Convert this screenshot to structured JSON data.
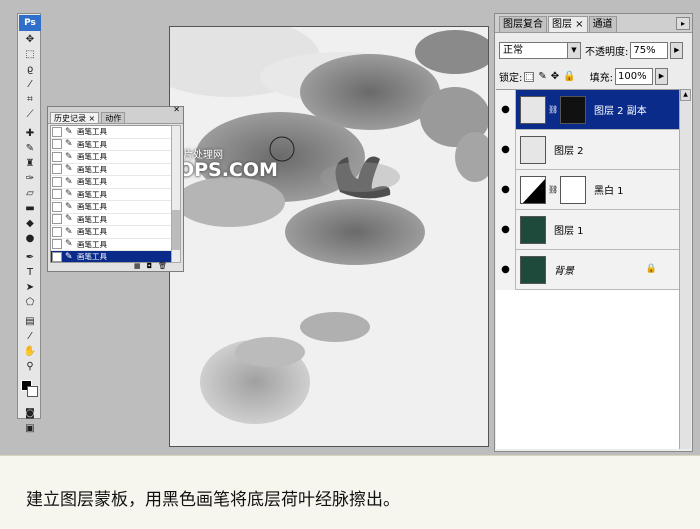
{
  "toolbox": {
    "logo": "Ps",
    "tools": [
      "move-icon",
      "marquee-icon",
      "lasso-icon",
      "magic-wand-icon",
      "crop-icon",
      "slice-icon",
      "healing-icon",
      "brush-icon",
      "stamp-icon",
      "history-brush-icon",
      "eraser-icon",
      "gradient-icon",
      "blur-icon",
      "dodge-icon",
      "pen-icon",
      "type-icon",
      "path-select-icon",
      "shape-icon",
      "notes-icon",
      "eyedropper-icon",
      "hand-icon",
      "zoom-icon"
    ],
    "foreground_color": "#000000",
    "background_color": "#ffffff"
  },
  "watermark": {
    "chinese": "照片处理网",
    "english": "PHOTOPS.COM"
  },
  "history": {
    "tabs": [
      {
        "label": "历史记录 ×"
      },
      {
        "label": "动作"
      }
    ],
    "items": [
      {
        "label": "画笔工具"
      },
      {
        "label": "画笔工具"
      },
      {
        "label": "画笔工具"
      },
      {
        "label": "画笔工具"
      },
      {
        "label": "画笔工具"
      },
      {
        "label": "画笔工具"
      },
      {
        "label": "画笔工具"
      },
      {
        "label": "画笔工具"
      },
      {
        "label": "画笔工具"
      },
      {
        "label": "画笔工具"
      },
      {
        "label": "画笔工具"
      }
    ],
    "selected_index": 10
  },
  "layers_panel": {
    "tabs": [
      {
        "label": "图层复合"
      },
      {
        "label": "图层 ×"
      },
      {
        "label": "通道"
      }
    ],
    "blend_mode": "正常",
    "opacity_label": "不透明度:",
    "opacity_value": "75%",
    "lock_label": "锁定:",
    "fill_label": "填充:",
    "fill_value": "100%",
    "layers": [
      {
        "name": "图层 2 副本",
        "selected": true,
        "has_mask": true
      },
      {
        "name": "图层 2",
        "selected": false,
        "has_mask": false
      },
      {
        "name": "黑白 1",
        "selected": false,
        "has_mask": true
      },
      {
        "name": "图层 1",
        "selected": false,
        "has_mask": false
      },
      {
        "name": "背景",
        "selected": false,
        "has_mask": false,
        "locked": true
      }
    ],
    "selection_color": "#0a2b8a"
  },
  "caption": {
    "text": "建立图层蒙板，用黑色画笔将底层荷叶经脉擦出。"
  }
}
